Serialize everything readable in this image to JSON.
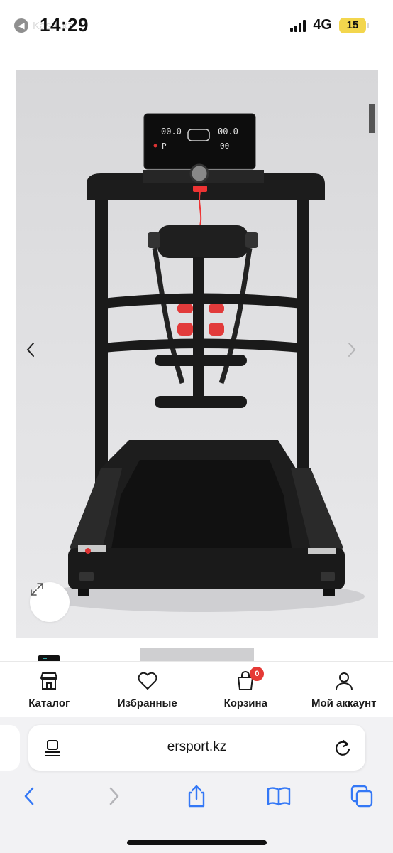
{
  "status_bar": {
    "back_app": "Kaspi.kz",
    "time": "14:29",
    "network": "4G",
    "battery": "15"
  },
  "product_image": {
    "display": {
      "left_value": "00.0",
      "right_value": "00.0",
      "mode": "P",
      "sub_value": "00"
    }
  },
  "bottom_nav": {
    "items": [
      {
        "label": "Каталог",
        "icon": "store-icon"
      },
      {
        "label": "Избранные",
        "icon": "heart-icon"
      },
      {
        "label": "Корзина",
        "icon": "cart-icon",
        "badge": "0"
      },
      {
        "label": "Мой аккаунт",
        "icon": "user-icon"
      }
    ]
  },
  "safari": {
    "url": "ersport.kz"
  },
  "colors": {
    "accent": "#3478f6",
    "badge": "#e53935",
    "battery": "#f3d64d"
  }
}
